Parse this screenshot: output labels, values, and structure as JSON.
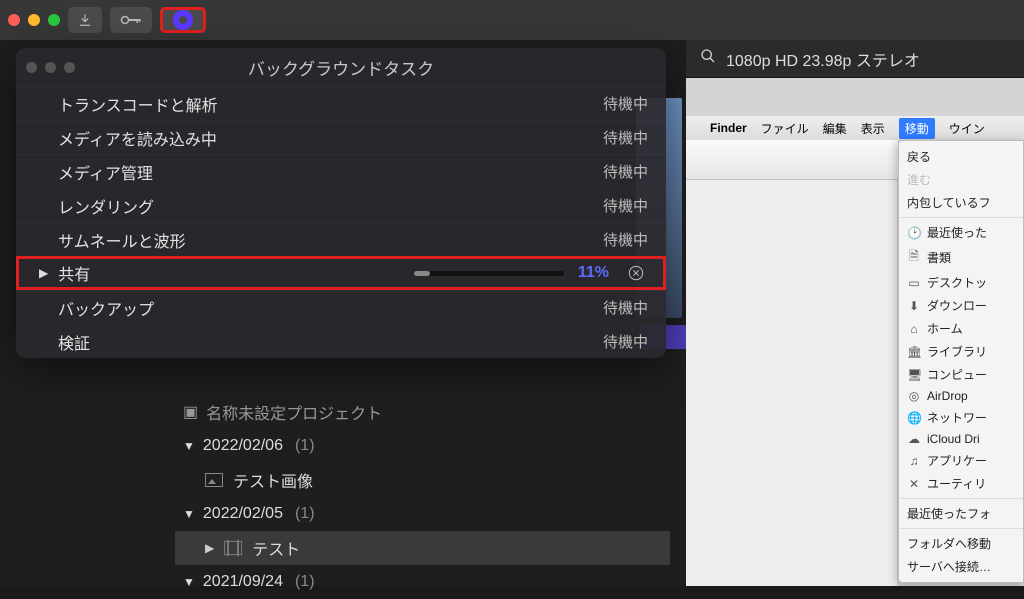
{
  "toolbar": {
    "download_tip": "download",
    "key_tip": "key"
  },
  "right_header": {
    "format": "1080p HD 23.98p ステレオ"
  },
  "popup": {
    "title": "バックグラウンドタスク",
    "waiting": "待機中",
    "rows": {
      "transcode": "トランスコードと解析",
      "import": "メディアを読み込み中",
      "media_mgmt": "メディア管理",
      "render": "レンダリング",
      "thumbs": "サムネールと波形",
      "share": "共有",
      "backup": "バックアップ",
      "verify": "検証"
    },
    "share_pct": "11%",
    "share_value": 11
  },
  "events": {
    "topline": "名称未設定プロジェクト",
    "g1_date": "2022/02/06",
    "g1_count": "(1)",
    "g1_item": "テスト画像",
    "g2_date": "2022/02/05",
    "g2_count": "(1)",
    "g2_item": "テスト",
    "g3_date": "2021/09/24",
    "g3_count": "(1)"
  },
  "finder": {
    "app": "Finder",
    "m_file": "ファイル",
    "m_edit": "編集",
    "m_view": "表示",
    "m_go": "移動",
    "m_win": "ウイン",
    "go_back": "戻る",
    "go_fwd": "進む",
    "go_encl": "内包しているフ",
    "go_recent": "最近使った",
    "go_docs": "書類",
    "go_desk": "デスクトッ",
    "go_dl": "ダウンロー",
    "go_home": "ホーム",
    "go_lib": "ライブラリ",
    "go_comp": "コンピュー",
    "go_airdrop": "AirDrop",
    "go_net": "ネットワー",
    "go_icloud": "iCloud Dri",
    "go_apps": "アプリケー",
    "go_util": "ユーティリ",
    "go_recentf": "最近使ったフォ",
    "go_goto": "フォルダへ移動",
    "go_server": "サーバへ接続…"
  }
}
